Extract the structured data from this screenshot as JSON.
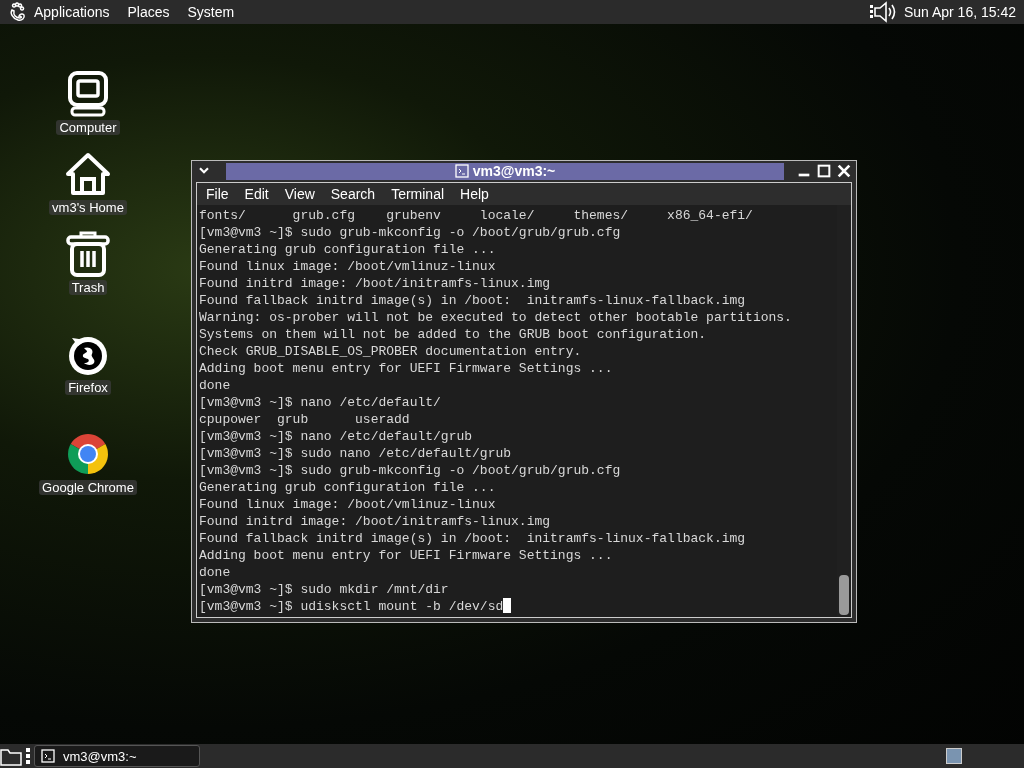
{
  "top_panel": {
    "menus": [
      "Applications",
      "Places",
      "System"
    ],
    "clock": "Sun Apr 16, 15:42"
  },
  "desktop_icons": [
    {
      "kind": "computer",
      "label": "Computer"
    },
    {
      "kind": "home",
      "label": "vm3's Home"
    },
    {
      "kind": "trash",
      "label": "Trash"
    },
    {
      "kind": "firefox",
      "label": "Firefox"
    },
    {
      "kind": "chrome",
      "label": "Google Chrome"
    }
  ],
  "window": {
    "title": "vm3@vm3:~",
    "menu": [
      "File",
      "Edit",
      "View",
      "Search",
      "Terminal",
      "Help"
    ],
    "lines": [
      "fonts/      grub.cfg    grubenv     locale/     themes/     x86_64-efi/",
      "[vm3@vm3 ~]$ sudo grub-mkconfig -o /boot/grub/grub.cfg",
      "Generating grub configuration file ...",
      "Found linux image: /boot/vmlinuz-linux",
      "Found initrd image: /boot/initramfs-linux.img",
      "Found fallback initrd image(s) in /boot:  initramfs-linux-fallback.img",
      "Warning: os-prober will not be executed to detect other bootable partitions.",
      "Systems on them will not be added to the GRUB boot configuration.",
      "Check GRUB_DISABLE_OS_PROBER documentation entry.",
      "Adding boot menu entry for UEFI Firmware Settings ...",
      "done",
      "[vm3@vm3 ~]$ nano /etc/default/",
      "cpupower  grub      useradd",
      "[vm3@vm3 ~]$ nano /etc/default/grub",
      "[vm3@vm3 ~]$ sudo nano /etc/default/grub",
      "[vm3@vm3 ~]$ sudo grub-mkconfig -o /boot/grub/grub.cfg",
      "Generating grub configuration file ...",
      "Found linux image: /boot/vmlinuz-linux",
      "Found initrd image: /boot/initramfs-linux.img",
      "Found fallback initrd image(s) in /boot:  initramfs-linux-fallback.img",
      "Adding boot menu entry for UEFI Firmware Settings ...",
      "done",
      "[vm3@vm3 ~]$ sudo mkdir /mnt/dir",
      "[vm3@vm3 ~]$ udisksctl mount -b /dev/sd"
    ]
  },
  "taskbar": {
    "tasks": [
      {
        "label": "vm3@vm3:~",
        "selected": false
      }
    ]
  }
}
